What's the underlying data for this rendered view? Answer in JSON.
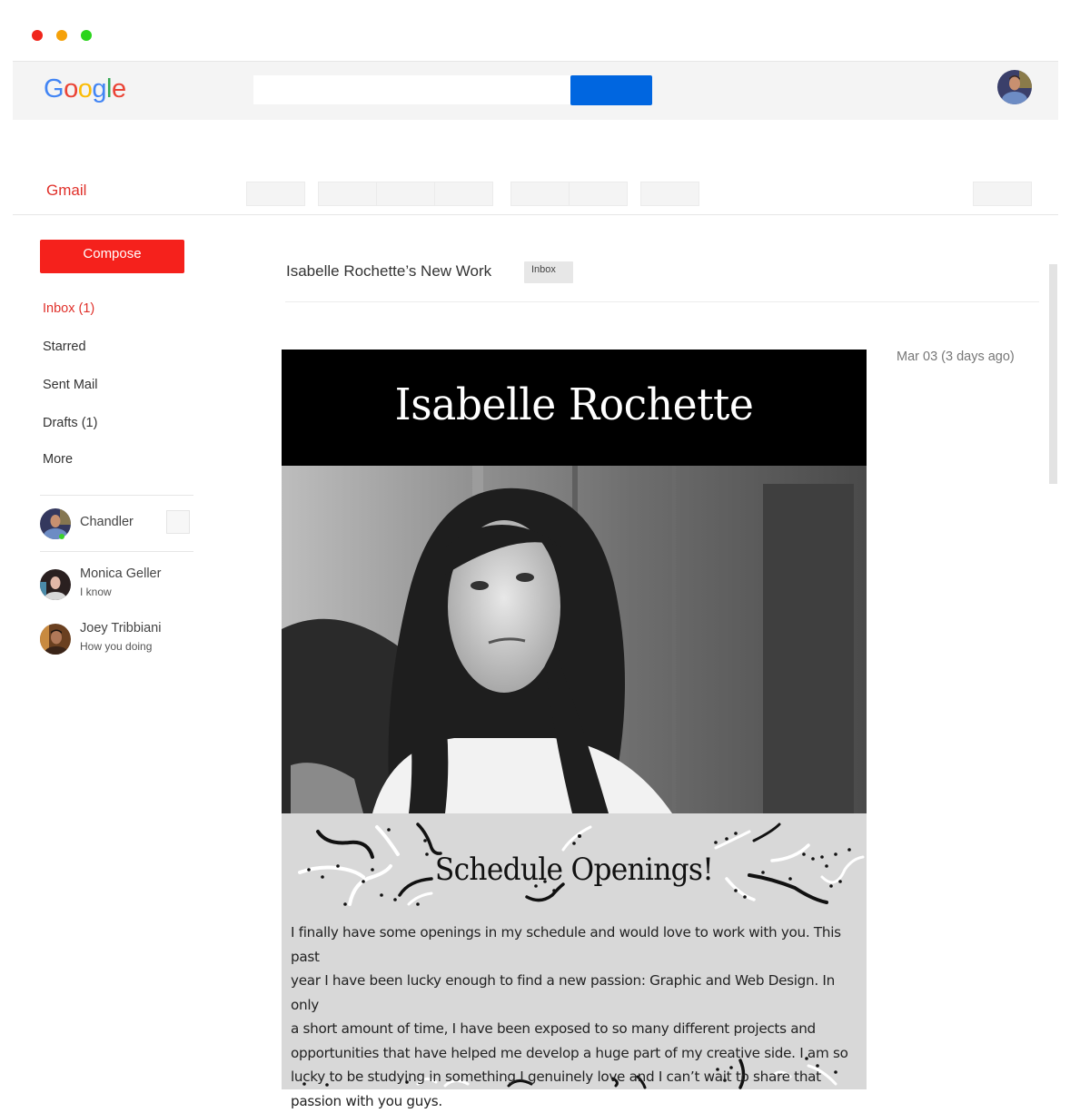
{
  "window": {
    "controls": [
      "close",
      "minimize",
      "maximize"
    ]
  },
  "header": {
    "logo": {
      "letters": [
        {
          "char": "G",
          "color": "#4285F4"
        },
        {
          "char": "o",
          "color": "#EA4335"
        },
        {
          "char": "o",
          "color": "#FBBC05"
        },
        {
          "char": "g",
          "color": "#4285F4"
        },
        {
          "char": "l",
          "color": "#34A853"
        },
        {
          "char": "e",
          "color": "#EA4335"
        }
      ]
    },
    "search": {
      "value": "",
      "placeholder": ""
    },
    "search_button_color": "#0066e0",
    "account_avatar": "user-avatar"
  },
  "toolbar": {
    "app_label": "Gmail",
    "buttons": [
      "action-1",
      "action-2",
      "action-3",
      "action-4",
      "action-5",
      "action-6",
      "action-7",
      "settings"
    ]
  },
  "sidebar": {
    "compose_label": "Compose",
    "nav": [
      {
        "label": "Inbox (1)",
        "active": true
      },
      {
        "label": "Starred",
        "active": false
      },
      {
        "label": "Sent Mail",
        "active": false
      },
      {
        "label": "Drafts (1)",
        "active": false
      },
      {
        "label": "More",
        "active": false
      }
    ],
    "contacts": [
      {
        "name": "Chandler",
        "status": "",
        "online": true
      },
      {
        "name": "Monica Geller",
        "status": "I know",
        "online": false
      },
      {
        "name": "Joey Tribbiani",
        "status": "How you doing",
        "online": false
      }
    ]
  },
  "message": {
    "subject": "Isabelle Rochette’s New Work",
    "label": "Inbox",
    "date": "Mar 03 (3 days ago)",
    "email": {
      "title": "Isabelle Rochette",
      "photo_alt": "black-and-white portrait photo",
      "section_title": "Schedule Openings!",
      "body_lines": [
        "I finally have some openings in my schedule and would love to work with you. This past",
        "year I have been lucky enough to find a new passion: Graphic and Web Design. In only",
        "a short amount of time, I have been exposed to so many different projects and",
        "opportunities that have helped me develop a huge part of my creative side. I am so",
        "lucky to be studying in something I genuinely love and I can’t wait to share that",
        "passion with you guys."
      ]
    }
  },
  "colors": {
    "accent_red": "#e0302a",
    "compose_red": "#f5211c",
    "online_green": "#39d12a"
  }
}
